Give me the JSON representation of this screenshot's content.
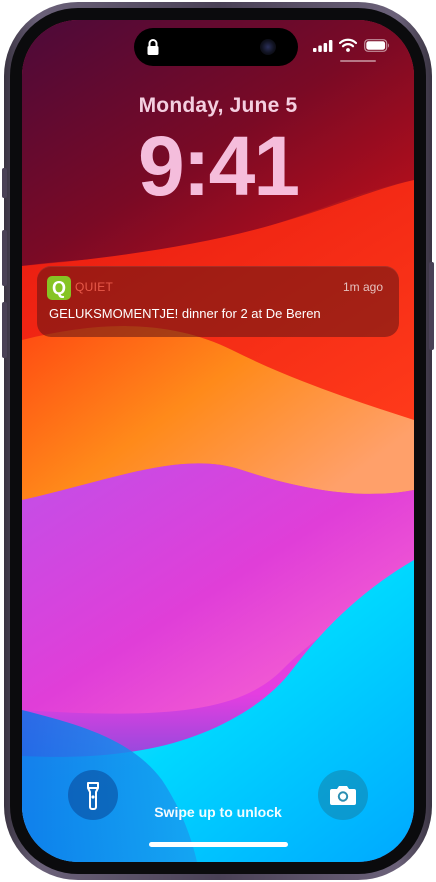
{
  "lock_screen": {
    "date": "Monday, June 5",
    "time": "9:41",
    "swipe_hint": "Swipe up to unlock"
  },
  "status_bar": {
    "icons": [
      "lock-icon",
      "signal-icon",
      "wifi-icon",
      "battery-icon"
    ]
  },
  "notification": {
    "app_icon_letter": "Q",
    "app_name": "QUIET",
    "time": "1m ago",
    "body": "GELUKSMOMENTJE!  dinner for 2 at De Beren",
    "colors": {
      "app_icon": "#86c424",
      "app_name": "#e85a4a"
    }
  },
  "quick_actions": {
    "left_icon": "flashlight-icon",
    "right_icon": "camera-icon"
  }
}
